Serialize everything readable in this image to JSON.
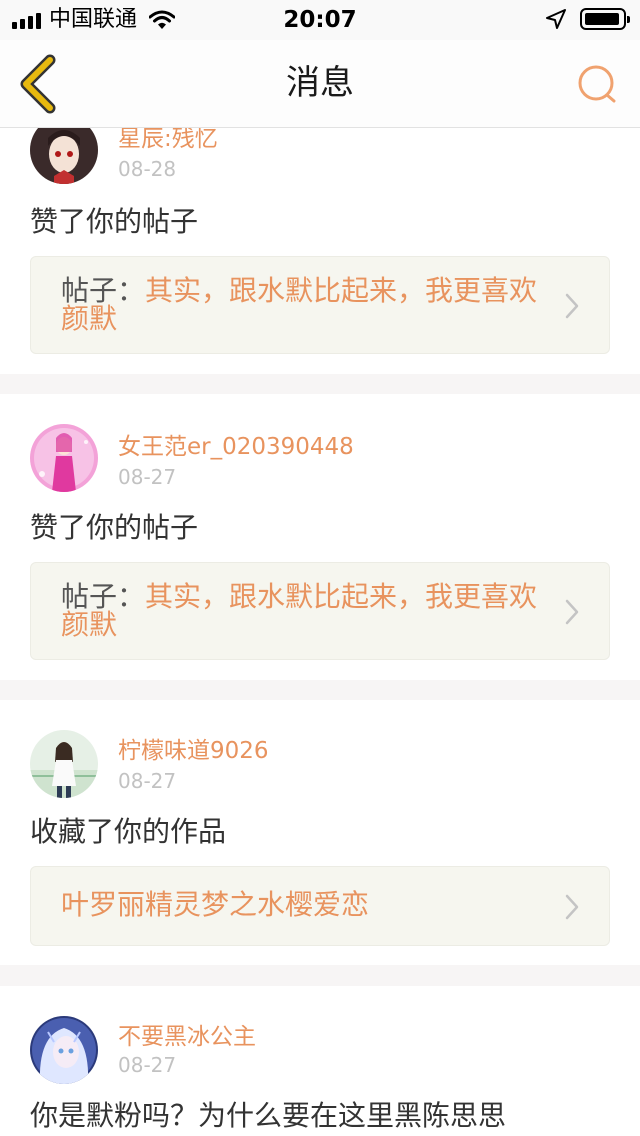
{
  "status_bar": {
    "carrier": "中国联通",
    "time": "20:07"
  },
  "header": {
    "title": "消息",
    "back_icon": "chevron-left-icon",
    "search_icon": "search-icon"
  },
  "colors": {
    "accent": "#e8935e",
    "back_icon": "#e7b90f",
    "date": "#c2c2c2",
    "ref_bg": "#f6f6ef"
  },
  "messages": [
    {
      "username": "星辰:残忆",
      "date": "08-28",
      "action": "赞了你的帖子",
      "ref_label": "帖子：",
      "ref_title": "其实，跟水默比起来，我更喜欢颜默"
    },
    {
      "username": "女王范er_020390448",
      "date": "08-27",
      "action": "赞了你的帖子",
      "ref_label": "帖子：",
      "ref_title": "其实，跟水默比起来，我更喜欢颜默"
    },
    {
      "username": "柠檬味道9026",
      "date": "08-27",
      "action": "收藏了你的作品",
      "ref_label": "",
      "ref_title": "叶罗丽精灵梦之水樱爱恋"
    },
    {
      "username": "不要黑冰公主",
      "date": "08-27",
      "action": "你是默粉吗？为什么要在这里黑陈思思"
    }
  ]
}
